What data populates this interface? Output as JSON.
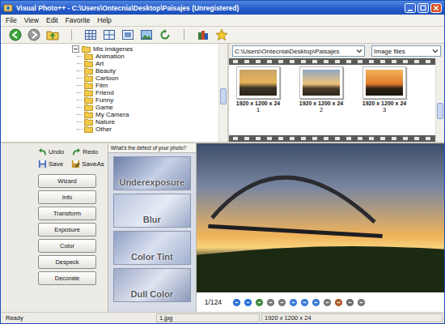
{
  "window": {
    "title": "Visual Photo++ - C:\\Users\\Ontecnia\\Desktop\\Paisajes  (Unregistered)"
  },
  "menu": [
    "File",
    "View",
    "Edit",
    "Favorite",
    "Help"
  ],
  "tree": {
    "root": "Mis imágenes",
    "expanded": true,
    "items": [
      "Animation",
      "Art",
      "Beauty",
      "Cartoon",
      "Film",
      "Friend",
      "Funny",
      "Game",
      "My Camera",
      "Nature",
      "Other"
    ]
  },
  "path": "C:\\Users\\Ontecnia\\Desktop\\Paisajes",
  "filter": "Image files",
  "thumbnails": [
    {
      "caption": "1920 x 1200 x 24",
      "number": "1",
      "selected": false
    },
    {
      "caption": "1920 x 1200 x 24",
      "number": "2",
      "selected": false
    },
    {
      "caption": "1920 x 1200 x 24",
      "number": "3",
      "selected": false
    }
  ],
  "actions": [
    "Undo",
    "Redo",
    "Save",
    "SaveAs"
  ],
  "tools": [
    "Wizard",
    "Info",
    "Transform",
    "Exposure",
    "Color",
    "Despeck",
    "Decorate"
  ],
  "defects": {
    "header": "What's the defect of your photo?",
    "items": [
      "Underexposure",
      "Blur",
      "Color Tint",
      "Dull Color"
    ]
  },
  "viewer": {
    "counter": "1/124"
  },
  "status_bar": [
    "Ready",
    "1.jpg",
    "1920 x 1200 x 24"
  ]
}
